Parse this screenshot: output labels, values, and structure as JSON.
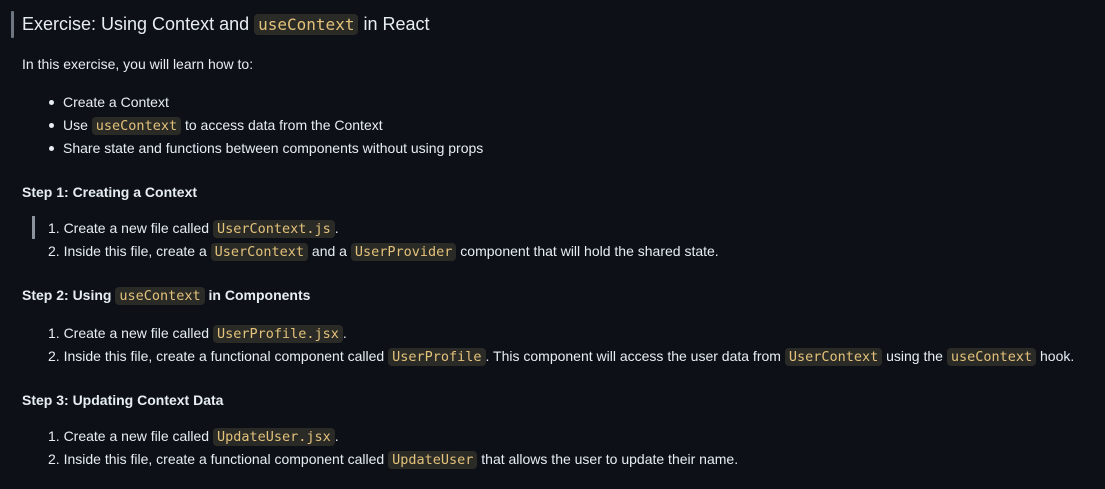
{
  "title": {
    "prefix": "Exercise: Using Context and ",
    "code": "useContext",
    "suffix": " in React"
  },
  "intro": "In this exercise, you will learn how to:",
  "bullets": {
    "b1": "Create a Context",
    "b2_prefix": "Use ",
    "b2_code": "useContext",
    "b2_suffix": " to access data from the Context",
    "b3": "Share state and functions between components without using props"
  },
  "step1": {
    "heading": "Step 1: Creating a Context",
    "item1_prefix": "1. Create a new file called ",
    "item1_code": "UserContext.js",
    "item1_suffix": ".",
    "item2_prefix": "2. Inside this file, create a ",
    "item2_code1": "UserContext",
    "item2_mid": " and a ",
    "item2_code2": "UserProvider",
    "item2_suffix": " component that will hold the shared state."
  },
  "step2": {
    "heading_prefix": "Step 2: Using ",
    "heading_code": "useContext",
    "heading_suffix": " in Components",
    "item1_prefix": "1. Create a new file called ",
    "item1_code": "UserProfile.jsx",
    "item1_suffix": ".",
    "item2_prefix": "2. Inside this file, create a functional component called ",
    "item2_code1": "UserProfile",
    "item2_mid1": ". This component will access the user data from ",
    "item2_code2": "UserContext",
    "item2_mid2": " using the ",
    "item2_code3": "useContext",
    "item2_suffix": " hook."
  },
  "step3": {
    "heading": "Step 3: Updating Context Data",
    "item1_prefix": "1. Create a new file called ",
    "item1_code": "UpdateUser.jsx",
    "item1_suffix": ".",
    "item2_prefix": "2. Inside this file, create a functional component called ",
    "item2_code": "UpdateUser",
    "item2_suffix": " that allows the user to update their name."
  },
  "colors": {
    "background": "#0d1117",
    "text": "#e6edf3",
    "code_text": "#e3c27a",
    "code_bg": "#2a2a27"
  }
}
